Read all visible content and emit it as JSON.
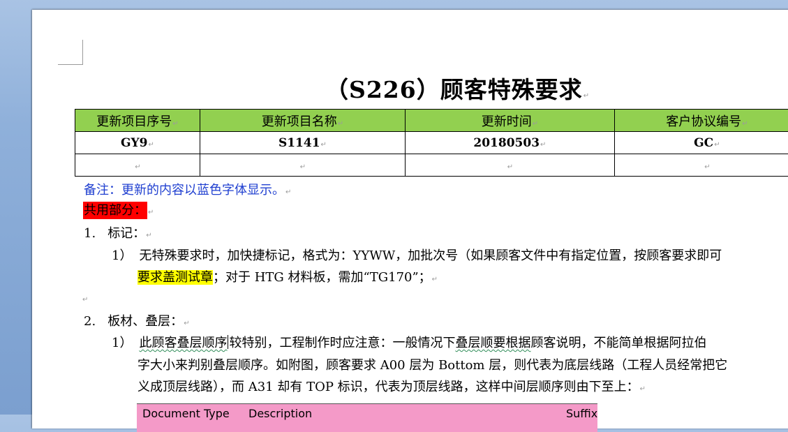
{
  "document": {
    "title": "（S226）顾客特殊要求",
    "paragraph_mark": "↵",
    "table": {
      "headers": [
        "更新项目序号",
        "更新项目名称",
        "更新时间",
        "客户协议编号"
      ],
      "row1": [
        "GY9",
        "S1141",
        "20180503",
        "GC"
      ],
      "row2": [
        "",
        "",
        "",
        ""
      ]
    },
    "note": "备注：更新的内容以蓝色字体显示。",
    "common_section": "共用部分：",
    "sections": [
      {
        "number": "1.",
        "heading": "标记：",
        "items": [
          {
            "number": "1）",
            "line1": "无特殊要求时，加快捷标记，格式为：YYWW，加批次号（如果顾客文件中有指定位置，按顾客要求即可",
            "line2_highlight": "要求盖测试章",
            "line2_rest": "；对于 HTG 材料板，需加“TG170”；"
          }
        ]
      },
      {
        "number": "2.",
        "heading": "板材、叠层：",
        "items": [
          {
            "number": "1）",
            "line1_a": "此顾客叠层顺序",
            "line1_b": "较特别，工程制作时应注意：一般情况下",
            "line1_c": "叠层顺要根据",
            "line1_d": "顾客说明，不能简单根据阿拉伯",
            "line2": "字大小来判别叠层顺序。如附图，顾客要求 A00 层为 Bottom 层，则代表为底层线路（工程人员经常把它",
            "line3": "义成顶层线路），而 A31 却有 TOP 标识，代表为顶层线路，这样中间层顺序则由下至上："
          }
        ]
      }
    ],
    "embedded_table": {
      "col1": "Document Type",
      "col2": "Description",
      "col3": "Suffix"
    }
  }
}
